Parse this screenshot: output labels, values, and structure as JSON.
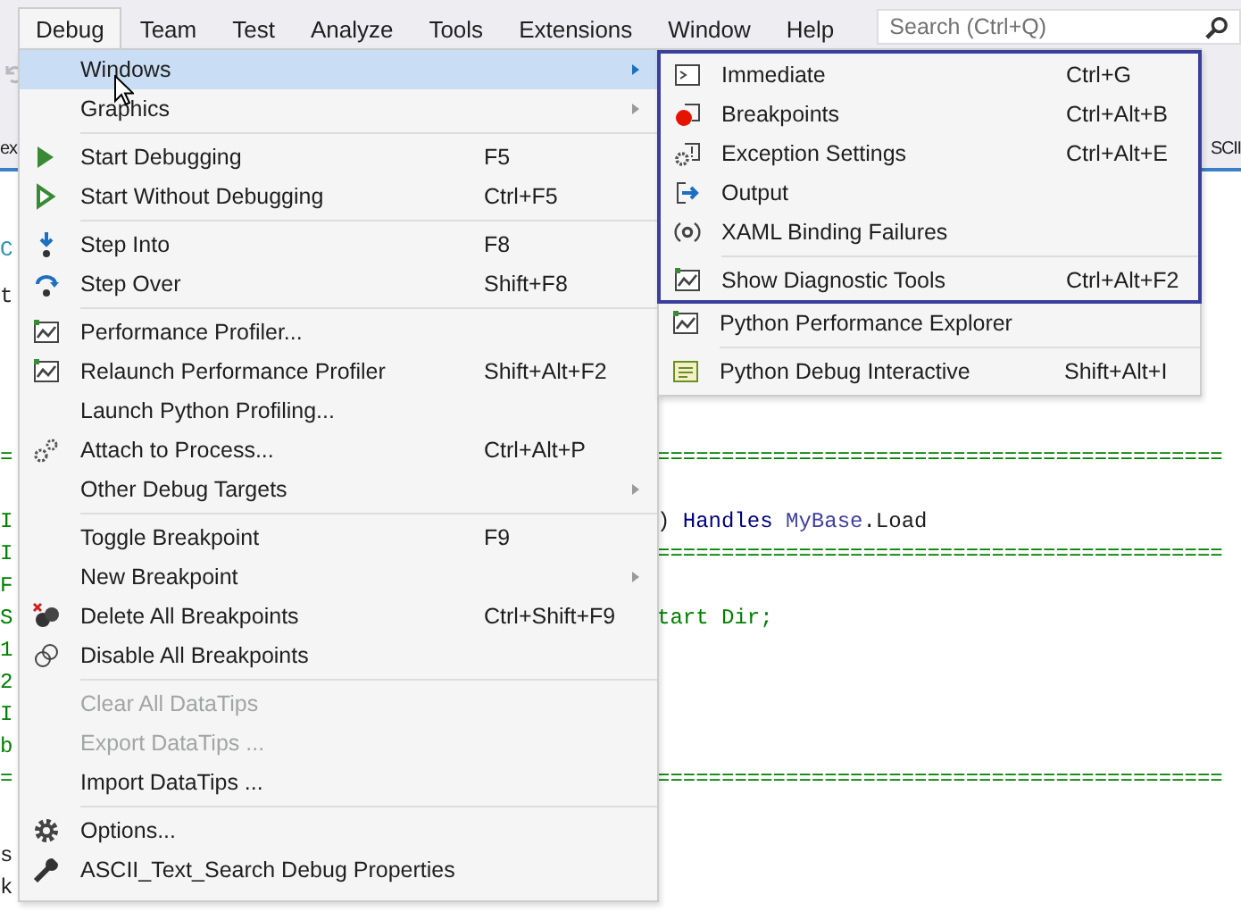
{
  "menubar": {
    "items": [
      {
        "label": "Debug",
        "selected": true
      },
      {
        "label": "Team",
        "selected": false
      },
      {
        "label": "Test",
        "selected": false
      },
      {
        "label": "Analyze",
        "selected": false
      },
      {
        "label": "Tools",
        "selected": false
      },
      {
        "label": "Extensions",
        "selected": false
      },
      {
        "label": "Window",
        "selected": false
      },
      {
        "label": "Help",
        "selected": false
      }
    ],
    "search": {
      "placeholder": "Search (Ctrl+Q)"
    }
  },
  "tabs": [
    {
      "label": "ex"
    },
    {
      "label": "SCII"
    }
  ],
  "editor": {
    "lines": [
      {
        "gutter": {
          "text": "C",
          "kind": "type"
        }
      },
      {
        "gutter": {
          "text": "t",
          "kind": "plain"
        }
      },
      {
        "gutter": {
          "text": "=",
          "kind": "comment"
        },
        "tokens": [
          {
            "text": "============================================",
            "kind": "comment"
          }
        ]
      },
      {
        "gutter": {
          "text": "I",
          "kind": "comment"
        },
        "tokens": [
          {
            "text": ")",
            "kind": "plain"
          },
          {
            "text": " Handles ",
            "kind": "keyword"
          },
          {
            "text": "MyBase",
            "kind": "keyword2"
          },
          {
            "text": ".Load",
            "kind": "plain"
          }
        ]
      },
      {
        "gutter": {
          "text": "I",
          "kind": "comment"
        },
        "tokens": [
          {
            "text": "============================================",
            "kind": "comment"
          }
        ]
      },
      {
        "gutter": {
          "text": "F",
          "kind": "comment"
        }
      },
      {
        "gutter": {
          "text": "S",
          "kind": "comment"
        },
        "tokens": [
          {
            "text": "tart Dir;",
            "kind": "comment"
          }
        ]
      },
      {
        "gutter": {
          "text": "1",
          "kind": "comment"
        }
      },
      {
        "gutter": {
          "text": "2",
          "kind": "comment"
        }
      },
      {
        "gutter": {
          "text": "I",
          "kind": "comment"
        }
      },
      {
        "gutter": {
          "text": "b",
          "kind": "comment"
        }
      },
      {
        "gutter": {
          "text": "=",
          "kind": "comment"
        },
        "tokens": [
          {
            "text": "============================================",
            "kind": "comment"
          }
        ]
      },
      {
        "gutter": {
          "text": "s",
          "kind": "plain"
        }
      },
      {
        "gutter": {
          "text": "k",
          "kind": "plain"
        }
      }
    ]
  },
  "menu": {
    "items": [
      {
        "kind": "plain",
        "label": "Windows",
        "submenu": true,
        "selected": true,
        "disabled": false
      },
      {
        "kind": "plain",
        "label": "Graphics",
        "submenu": true,
        "selected": false,
        "disabled": false
      },
      {
        "kind": "separator"
      },
      {
        "kind": "play",
        "label": "Start Debugging",
        "shortcut": "F5",
        "submenu": false,
        "selected": false,
        "disabled": false
      },
      {
        "kind": "run",
        "label": "Start Without Debugging",
        "shortcut": "Ctrl+F5",
        "submenu": false,
        "selected": false,
        "disabled": false
      },
      {
        "kind": "separator"
      },
      {
        "kind": "stepinto",
        "label": "Step Into",
        "shortcut": "F8",
        "submenu": false,
        "selected": false,
        "disabled": false
      },
      {
        "kind": "stepover",
        "label": "Step Over",
        "shortcut": "Shift+F8",
        "submenu": false,
        "selected": false,
        "disabled": false
      },
      {
        "kind": "separator"
      },
      {
        "kind": "profiler",
        "label": "Performance Profiler...",
        "submenu": false,
        "selected": false,
        "disabled": false
      },
      {
        "kind": "profiler",
        "label": "Relaunch Performance Profiler",
        "shortcut": "Shift+Alt+F2",
        "submenu": false,
        "selected": false,
        "disabled": false
      },
      {
        "kind": "plain",
        "label": "Launch Python Profiling...",
        "submenu": false,
        "selected": false,
        "disabled": false
      },
      {
        "kind": "attach",
        "label": "Attach to Process...",
        "shortcut": "Ctrl+Alt+P",
        "submenu": false,
        "selected": false,
        "disabled": false
      },
      {
        "kind": "plain",
        "label": "Other Debug Targets",
        "submenu": true,
        "selected": false,
        "disabled": false
      },
      {
        "kind": "separator"
      },
      {
        "kind": "plain",
        "label": "Toggle Breakpoint",
        "shortcut": "F9",
        "submenu": false,
        "selected": false,
        "disabled": false
      },
      {
        "kind": "plain",
        "label": "New Breakpoint",
        "submenu": true,
        "selected": false,
        "disabled": false
      },
      {
        "kind": "deleteall",
        "label": "Delete All Breakpoints",
        "shortcut": "Ctrl+Shift+F9",
        "submenu": false,
        "selected": false,
        "disabled": false
      },
      {
        "kind": "disableall",
        "label": "Disable All Breakpoints",
        "submenu": false,
        "selected": false,
        "disabled": false
      },
      {
        "kind": "separator"
      },
      {
        "kind": "plain",
        "label": "Clear All DataTips",
        "submenu": false,
        "selected": false,
        "disabled": true
      },
      {
        "kind": "plain",
        "label": "Export DataTips ...",
        "submenu": false,
        "selected": false,
        "disabled": true
      },
      {
        "kind": "plain",
        "label": "Import DataTips ...",
        "submenu": false,
        "selected": false,
        "disabled": false
      },
      {
        "kind": "separator"
      },
      {
        "kind": "options",
        "label": "Options...",
        "submenu": false,
        "selected": false,
        "disabled": false
      },
      {
        "kind": "properties",
        "label": "ASCII_Text_Search Debug Properties",
        "submenu": false,
        "selected": false,
        "disabled": false
      }
    ]
  },
  "submenu": {
    "items": [
      {
        "kind": "immediate",
        "label": "Immediate",
        "shortcut": "Ctrl+G",
        "framed": true
      },
      {
        "kind": "breakpoints",
        "label": "Breakpoints",
        "shortcut": "Ctrl+Alt+B",
        "framed": true
      },
      {
        "kind": "exceptions",
        "label": "Exception Settings",
        "shortcut": "Ctrl+Alt+E",
        "framed": true
      },
      {
        "kind": "output",
        "label": "Output",
        "framed": true
      },
      {
        "kind": "xaml",
        "label": "XAML Binding Failures",
        "framed": true
      },
      {
        "kind": "separator",
        "framed": true
      },
      {
        "kind": "profiler",
        "label": "Show Diagnostic Tools",
        "shortcut": "Ctrl+Alt+F2",
        "framed": true
      },
      {
        "kind": "profiler",
        "label": "Python Performance Explorer",
        "framed": false
      },
      {
        "kind": "separator",
        "framed": false
      },
      {
        "kind": "interactive",
        "label": "Python Debug Interactive",
        "shortcut": "Shift+Alt+I",
        "framed": false
      }
    ]
  }
}
